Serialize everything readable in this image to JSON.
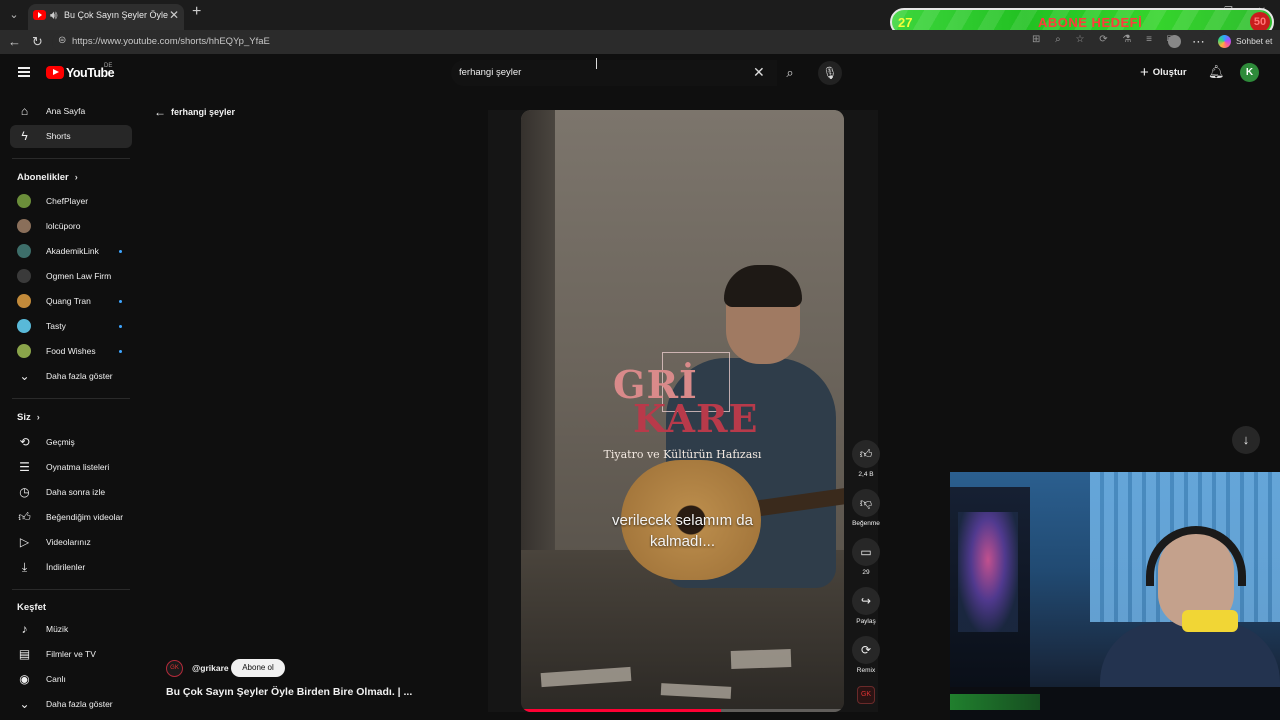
{
  "browser": {
    "tab_title": "Bu Çok Sayın Şeyler Öyle Birden Bire Olmadı",
    "url": "https://www.youtube.com/shorts/hhEQYp_YfaE",
    "chat_label": "Sohbet et"
  },
  "overlay": {
    "current": "27",
    "label": "ABONE HEDEFİ",
    "goal": "50",
    "bar_color": "#22c122"
  },
  "youtube": {
    "logo_text": "YouTube",
    "region": "DE",
    "search_value": "ferhangi şeyler",
    "create_label": "Oluştur",
    "avatar_letter": "K"
  },
  "sidebar": {
    "main": [
      {
        "label": "Ana Sayfa",
        "icon": "home-icon"
      },
      {
        "label": "Shorts",
        "icon": "shorts-icon"
      }
    ],
    "subs_heading": "Abonelikler",
    "subscriptions": [
      {
        "label": "ChefPlayer",
        "color": "#6b8e3a",
        "live": false
      },
      {
        "label": "lolcüporo",
        "color": "#8a6f5a",
        "live": false
      },
      {
        "label": "AkademikLink",
        "color": "#3d6e6a",
        "live": true
      },
      {
        "label": "Ogmen Law Firm",
        "color": "#3a3a3a",
        "live": false
      },
      {
        "label": "Quang Tran",
        "color": "#c28a3a",
        "live": true
      },
      {
        "label": "Tasty",
        "color": "#59b9d8",
        "live": true
      },
      {
        "label": "Food Wishes",
        "color": "#8aa44a",
        "live": true
      }
    ],
    "subs_more": "Daha fazla göster",
    "you_heading": "Siz",
    "you_items": [
      {
        "label": "Geçmiş",
        "icon": "history-icon"
      },
      {
        "label": "Oynatma listeleri",
        "icon": "playlists-icon"
      },
      {
        "label": "Daha sonra izle",
        "icon": "watch-later-icon"
      },
      {
        "label": "Beğendiğim videolar",
        "icon": "liked-videos-icon"
      },
      {
        "label": "Videolarınız",
        "icon": "your-videos-icon"
      },
      {
        "label": "İndirilenler",
        "icon": "downloads-icon"
      }
    ],
    "explore_heading": "Keşfet",
    "explore_items": [
      {
        "label": "Müzik",
        "icon": "music-icon"
      },
      {
        "label": "Filmler ve TV",
        "icon": "movies-icon"
      },
      {
        "label": "Canlı",
        "icon": "live-icon"
      },
      {
        "label": "Daha fazla göster",
        "icon": "chevron-down-icon"
      }
    ]
  },
  "main": {
    "back_label": "ferhangi şeyler",
    "video": {
      "logo_line1": "GRİ",
      "logo_line2": "KARE",
      "logo_sub": "Tiyatro ve Kültürün Hafızası",
      "caption_line1": "verilecek selamım da",
      "caption_line2": "kalmadı...",
      "progress": 0.62
    },
    "channel": {
      "handle": "@grikare",
      "subscribe_label": "Abone ol"
    },
    "title": "Bu Çok Sayın Şeyler Öyle Birden Bire Olmadı. | ...",
    "actions": {
      "like_count": "2,4 B",
      "dislike_label": "Beğenme",
      "comment_count": "29",
      "share_label": "Paylaş",
      "remix_label": "Remix"
    }
  }
}
